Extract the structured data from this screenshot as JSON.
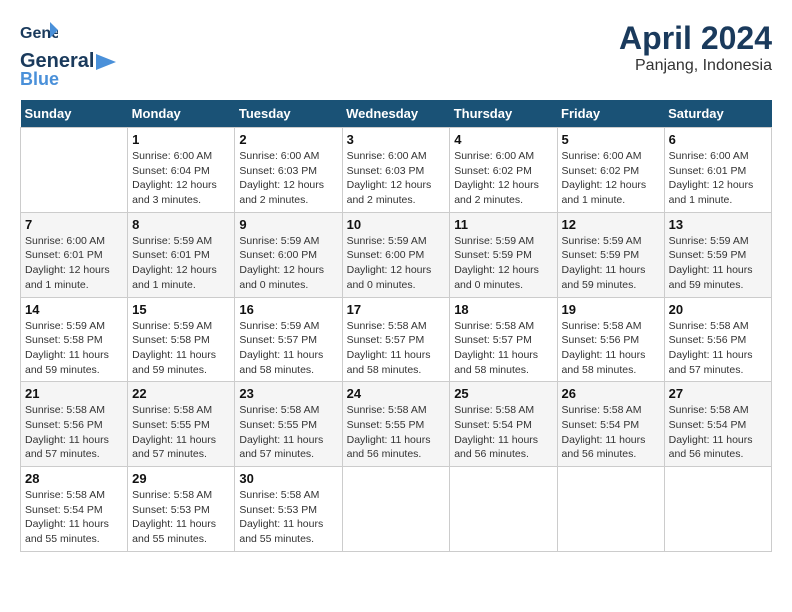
{
  "header": {
    "logo_general": "General",
    "logo_blue": "Blue",
    "month_title": "April 2024",
    "subtitle": "Panjang, Indonesia"
  },
  "calendar": {
    "days_of_week": [
      "Sunday",
      "Monday",
      "Tuesday",
      "Wednesday",
      "Thursday",
      "Friday",
      "Saturday"
    ],
    "weeks": [
      [
        {
          "day": "",
          "info": ""
        },
        {
          "day": "1",
          "info": "Sunrise: 6:00 AM\nSunset: 6:04 PM\nDaylight: 12 hours\nand 3 minutes."
        },
        {
          "day": "2",
          "info": "Sunrise: 6:00 AM\nSunset: 6:03 PM\nDaylight: 12 hours\nand 2 minutes."
        },
        {
          "day": "3",
          "info": "Sunrise: 6:00 AM\nSunset: 6:03 PM\nDaylight: 12 hours\nand 2 minutes."
        },
        {
          "day": "4",
          "info": "Sunrise: 6:00 AM\nSunset: 6:02 PM\nDaylight: 12 hours\nand 2 minutes."
        },
        {
          "day": "5",
          "info": "Sunrise: 6:00 AM\nSunset: 6:02 PM\nDaylight: 12 hours\nand 1 minute."
        },
        {
          "day": "6",
          "info": "Sunrise: 6:00 AM\nSunset: 6:01 PM\nDaylight: 12 hours\nand 1 minute."
        }
      ],
      [
        {
          "day": "7",
          "info": "Sunrise: 6:00 AM\nSunset: 6:01 PM\nDaylight: 12 hours\nand 1 minute."
        },
        {
          "day": "8",
          "info": "Sunrise: 5:59 AM\nSunset: 6:01 PM\nDaylight: 12 hours\nand 1 minute."
        },
        {
          "day": "9",
          "info": "Sunrise: 5:59 AM\nSunset: 6:00 PM\nDaylight: 12 hours\nand 0 minutes."
        },
        {
          "day": "10",
          "info": "Sunrise: 5:59 AM\nSunset: 6:00 PM\nDaylight: 12 hours\nand 0 minutes."
        },
        {
          "day": "11",
          "info": "Sunrise: 5:59 AM\nSunset: 5:59 PM\nDaylight: 12 hours\nand 0 minutes."
        },
        {
          "day": "12",
          "info": "Sunrise: 5:59 AM\nSunset: 5:59 PM\nDaylight: 11 hours\nand 59 minutes."
        },
        {
          "day": "13",
          "info": "Sunrise: 5:59 AM\nSunset: 5:59 PM\nDaylight: 11 hours\nand 59 minutes."
        }
      ],
      [
        {
          "day": "14",
          "info": "Sunrise: 5:59 AM\nSunset: 5:58 PM\nDaylight: 11 hours\nand 59 minutes."
        },
        {
          "day": "15",
          "info": "Sunrise: 5:59 AM\nSunset: 5:58 PM\nDaylight: 11 hours\nand 59 minutes."
        },
        {
          "day": "16",
          "info": "Sunrise: 5:59 AM\nSunset: 5:57 PM\nDaylight: 11 hours\nand 58 minutes."
        },
        {
          "day": "17",
          "info": "Sunrise: 5:58 AM\nSunset: 5:57 PM\nDaylight: 11 hours\nand 58 minutes."
        },
        {
          "day": "18",
          "info": "Sunrise: 5:58 AM\nSunset: 5:57 PM\nDaylight: 11 hours\nand 58 minutes."
        },
        {
          "day": "19",
          "info": "Sunrise: 5:58 AM\nSunset: 5:56 PM\nDaylight: 11 hours\nand 58 minutes."
        },
        {
          "day": "20",
          "info": "Sunrise: 5:58 AM\nSunset: 5:56 PM\nDaylight: 11 hours\nand 57 minutes."
        }
      ],
      [
        {
          "day": "21",
          "info": "Sunrise: 5:58 AM\nSunset: 5:56 PM\nDaylight: 11 hours\nand 57 minutes."
        },
        {
          "day": "22",
          "info": "Sunrise: 5:58 AM\nSunset: 5:55 PM\nDaylight: 11 hours\nand 57 minutes."
        },
        {
          "day": "23",
          "info": "Sunrise: 5:58 AM\nSunset: 5:55 PM\nDaylight: 11 hours\nand 57 minutes."
        },
        {
          "day": "24",
          "info": "Sunrise: 5:58 AM\nSunset: 5:55 PM\nDaylight: 11 hours\nand 56 minutes."
        },
        {
          "day": "25",
          "info": "Sunrise: 5:58 AM\nSunset: 5:54 PM\nDaylight: 11 hours\nand 56 minutes."
        },
        {
          "day": "26",
          "info": "Sunrise: 5:58 AM\nSunset: 5:54 PM\nDaylight: 11 hours\nand 56 minutes."
        },
        {
          "day": "27",
          "info": "Sunrise: 5:58 AM\nSunset: 5:54 PM\nDaylight: 11 hours\nand 56 minutes."
        }
      ],
      [
        {
          "day": "28",
          "info": "Sunrise: 5:58 AM\nSunset: 5:54 PM\nDaylight: 11 hours\nand 55 minutes."
        },
        {
          "day": "29",
          "info": "Sunrise: 5:58 AM\nSunset: 5:53 PM\nDaylight: 11 hours\nand 55 minutes."
        },
        {
          "day": "30",
          "info": "Sunrise: 5:58 AM\nSunset: 5:53 PM\nDaylight: 11 hours\nand 55 minutes."
        },
        {
          "day": "",
          "info": ""
        },
        {
          "day": "",
          "info": ""
        },
        {
          "day": "",
          "info": ""
        },
        {
          "day": "",
          "info": ""
        }
      ]
    ]
  }
}
